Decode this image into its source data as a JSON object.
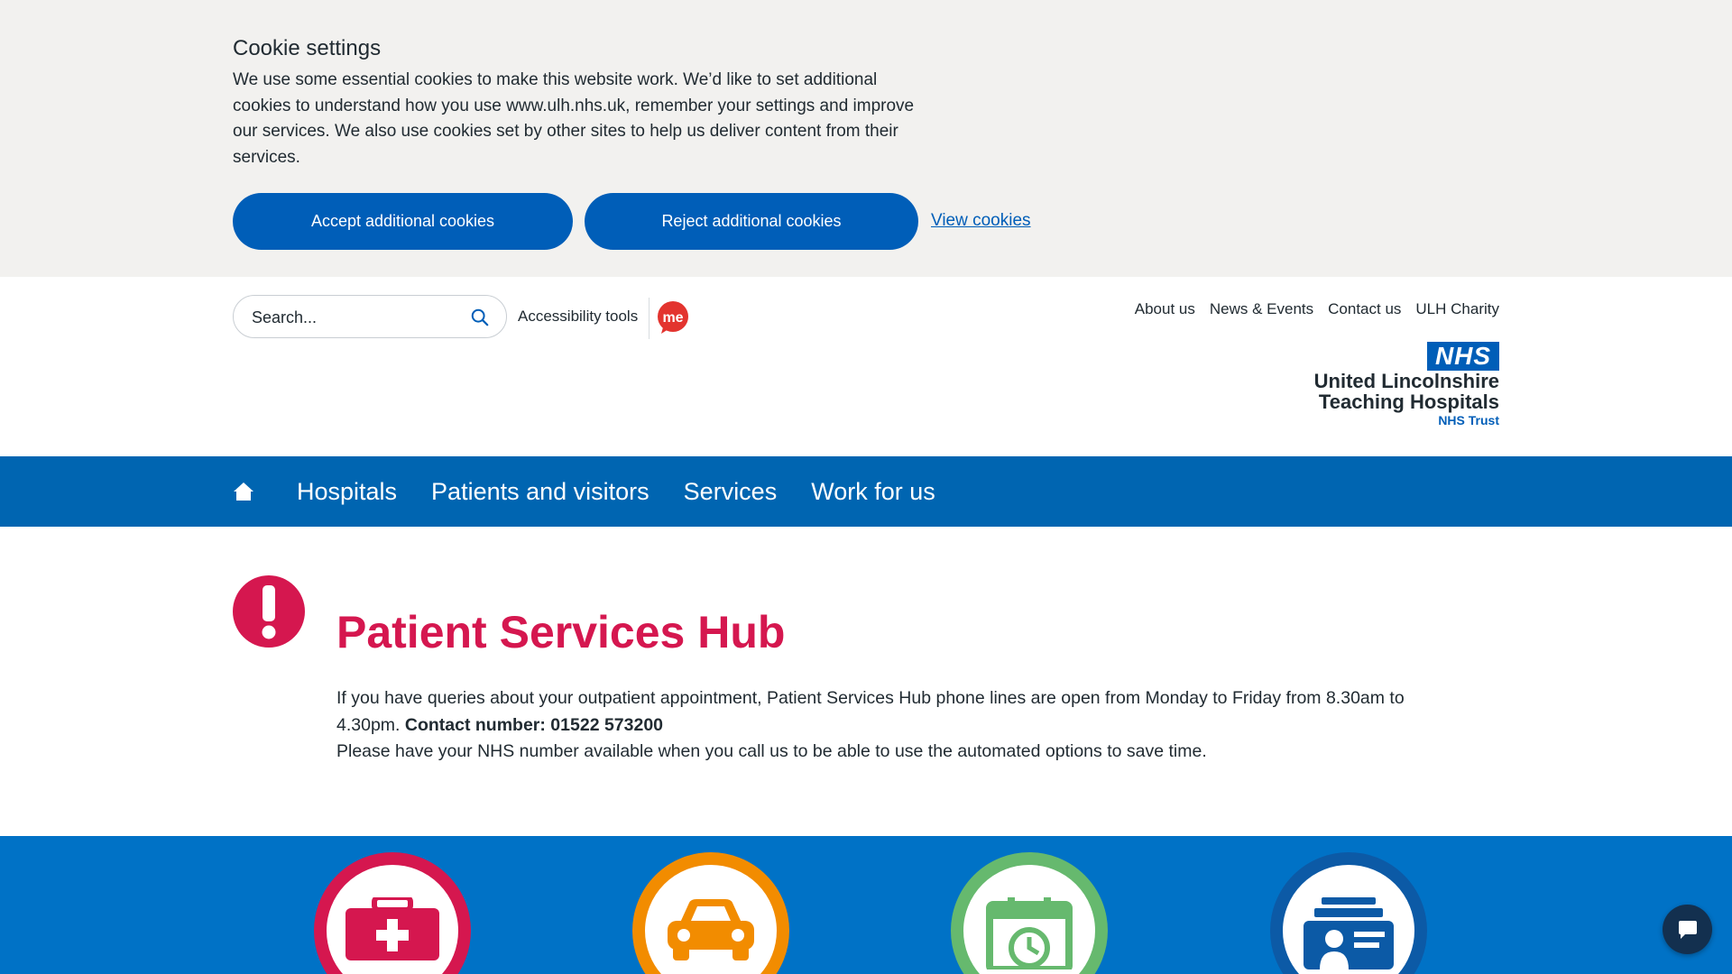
{
  "cookie_banner": {
    "title": "Cookie settings",
    "text": "We use some essential cookies to make this website work. We’d like to set additional cookies to understand how you use www.ulh.nhs.uk, remember your settings and improve our services. We also use cookies set by other sites to help us deliver content from their services.",
    "accept_label": "Accept additional cookies",
    "reject_label": "Reject additional cookies",
    "view_label": "View cookies"
  },
  "header": {
    "search_placeholder": "Search...",
    "accessibility_label": "Accessibility tools",
    "me_badge": "me",
    "top_links": [
      "About us",
      "News & Events",
      "Contact us",
      "ULH Charity"
    ],
    "logo": {
      "nhs": "NHS",
      "line1": "United Lincolnshire",
      "line2": "Teaching Hospitals",
      "trust": "NHS Trust"
    }
  },
  "nav": {
    "home_icon": "home-icon",
    "items": [
      "Hospitals",
      "Patients and visitors",
      "Services",
      "Work for us"
    ]
  },
  "alert": {
    "title": "Patient Services Hub",
    "text1": "If you have queries about your outpatient appointment, Patient Services Hub phone lines are open from Monday to Friday from 8.30am to 4.30pm.",
    "contact": "Contact number: 01522 573200",
    "text2": "Please have your NHS number available when you call us to be able to use the automated options to save time."
  },
  "tiles": [
    {
      "icon": "first-aid-kit-icon",
      "color": "#d5174f"
    },
    {
      "icon": "car-icon",
      "color": "#f28c00"
    },
    {
      "icon": "calendar-clock-icon",
      "color": "#66b96e"
    },
    {
      "icon": "id-card-icon",
      "color": "#0c5aa6"
    }
  ],
  "colors": {
    "nhs_blue": "#005eb8",
    "nav_blue": "#0065b1",
    "alert_red": "#d5174f",
    "band_blue": "#0072c6"
  }
}
